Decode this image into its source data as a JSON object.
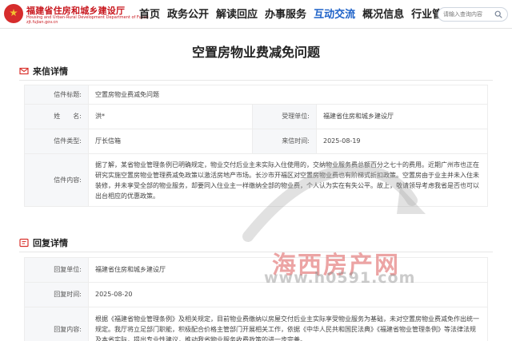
{
  "site": {
    "name": "福建省住房和城乡建设厅",
    "subtitle": "Housing and Urban-Rural Development Department of Fujian",
    "url": "zjt.fujian.gov.cn"
  },
  "nav": {
    "items": [
      {
        "label": "首页"
      },
      {
        "label": "政务公开"
      },
      {
        "label": "解读回应"
      },
      {
        "label": "办事服务"
      },
      {
        "label": "互动交流",
        "active": true
      },
      {
        "label": "概况信息"
      },
      {
        "label": "行业管理"
      }
    ],
    "active_color": "#1e62c8"
  },
  "search": {
    "placeholder": "请输入查询内容"
  },
  "page": {
    "title": "空置房物业费减免问题"
  },
  "letter": {
    "section_title": "来信详情",
    "title_label": "信件标题:",
    "title_value": "空置房物业费减免问题",
    "name_label": "姓　　名:",
    "name_value": "洪*",
    "receiver_label": "受理单位:",
    "receiver_value": "福建省住房和城乡建设厅",
    "type_label": "信件类型:",
    "type_value": "厅长信箱",
    "date_label": "来信时间:",
    "date_value": "2025-08-19",
    "content_label": "信件内容:",
    "content_value": "据了解，某省物业管理条例已明确规定，物业交付后业主未实际入住使用的，交纳物业服务费总额百分之七十的费用。近期广州市也正在研究实施空置房物业管理费减免政策以激活房地产市场。长沙市开福区对空置房物业费也有阶梯式折扣政策。空置房由于业主并未入住未装修，并未享受全部的物业服务，却要同入住业主一样缴纳全部的物业费，个人认为实在有失公平。故上，敬请领导考虑我省是否也可以出台相应的优惠政策。"
  },
  "reply": {
    "section_title": "回复详情",
    "unit_label": "回复单位:",
    "unit_value": "福建省住房和城乡建设厅",
    "date_label": "回复时间:",
    "date_value": "2025-08-20",
    "content_label": "回复内容:",
    "content_value": "根据《福建省物业管理条例》及相关规定，目前物业费缴纳以房屋交付后业主实际享受物业服务为基础，未对空置房物业费减免作出统一规定。我厅将立足部门职能，积极配合价格主管部门开展相关工作，依据《中华人民共和国民法典》《福建省物业管理条例》等法律法规及本省实际，提出专业性建议，推动我省物业服务收费政策的进一步完善。"
  },
  "watermark": {
    "text": "海西房产网",
    "url": "www.h0591.com"
  },
  "colors": {
    "brand_red": "#c8161d",
    "accent_blue": "#1e62c8",
    "label_bg": "#f6f7f9"
  }
}
